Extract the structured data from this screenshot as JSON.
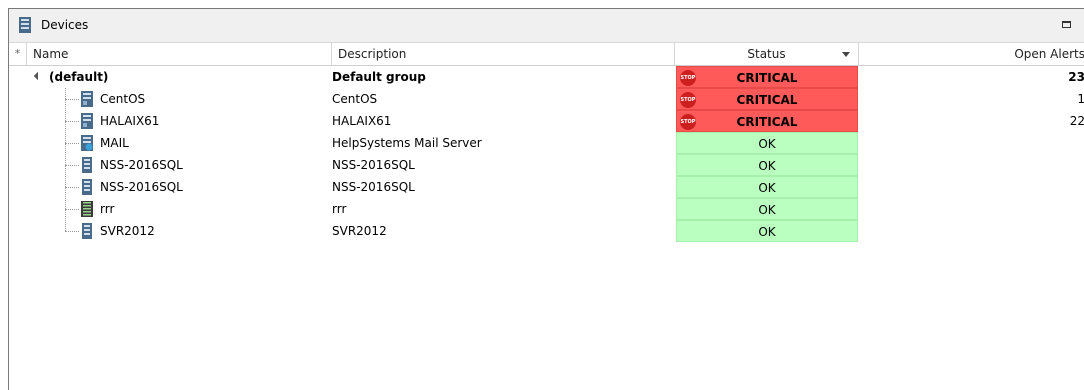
{
  "window": {
    "title": "Devices"
  },
  "columns": {
    "star": "*",
    "name": "Name",
    "description": "Description",
    "status": "Status",
    "open_alerts": "Open Alerts"
  },
  "rows": [
    {
      "name": "(default)",
      "description": "Default group",
      "status": "CRITICAL",
      "open_alerts": "23",
      "group": true,
      "icon": "group-icon"
    },
    {
      "name": "CentOS",
      "description": "CentOS",
      "status": "CRITICAL",
      "open_alerts": "1",
      "icon": "server-icon"
    },
    {
      "name": "HALAIX61",
      "description": "HALAIX61",
      "status": "CRITICAL",
      "open_alerts": "22",
      "icon": "server-icon"
    },
    {
      "name": "MAIL",
      "description": "HelpSystems Mail Server",
      "status": "OK",
      "open_alerts": "",
      "icon": "mail-server-icon"
    },
    {
      "name": "NSS-2016SQL",
      "description": "NSS-2016SQL",
      "status": "OK",
      "open_alerts": "",
      "icon": "server-icon"
    },
    {
      "name": "NSS-2016SQL",
      "description": "NSS-2016SQL",
      "status": "OK",
      "open_alerts": "",
      "icon": "server-icon"
    },
    {
      "name": "rrr",
      "description": "rrr",
      "status": "OK",
      "open_alerts": "",
      "icon": "rack-server-icon"
    },
    {
      "name": "SVR2012",
      "description": "SVR2012",
      "status": "OK",
      "open_alerts": "",
      "icon": "server-icon"
    }
  ],
  "status_badge": {
    "stop": "STOP"
  },
  "colors": {
    "critical": "#ff5a5a",
    "ok": "#baffc0"
  }
}
